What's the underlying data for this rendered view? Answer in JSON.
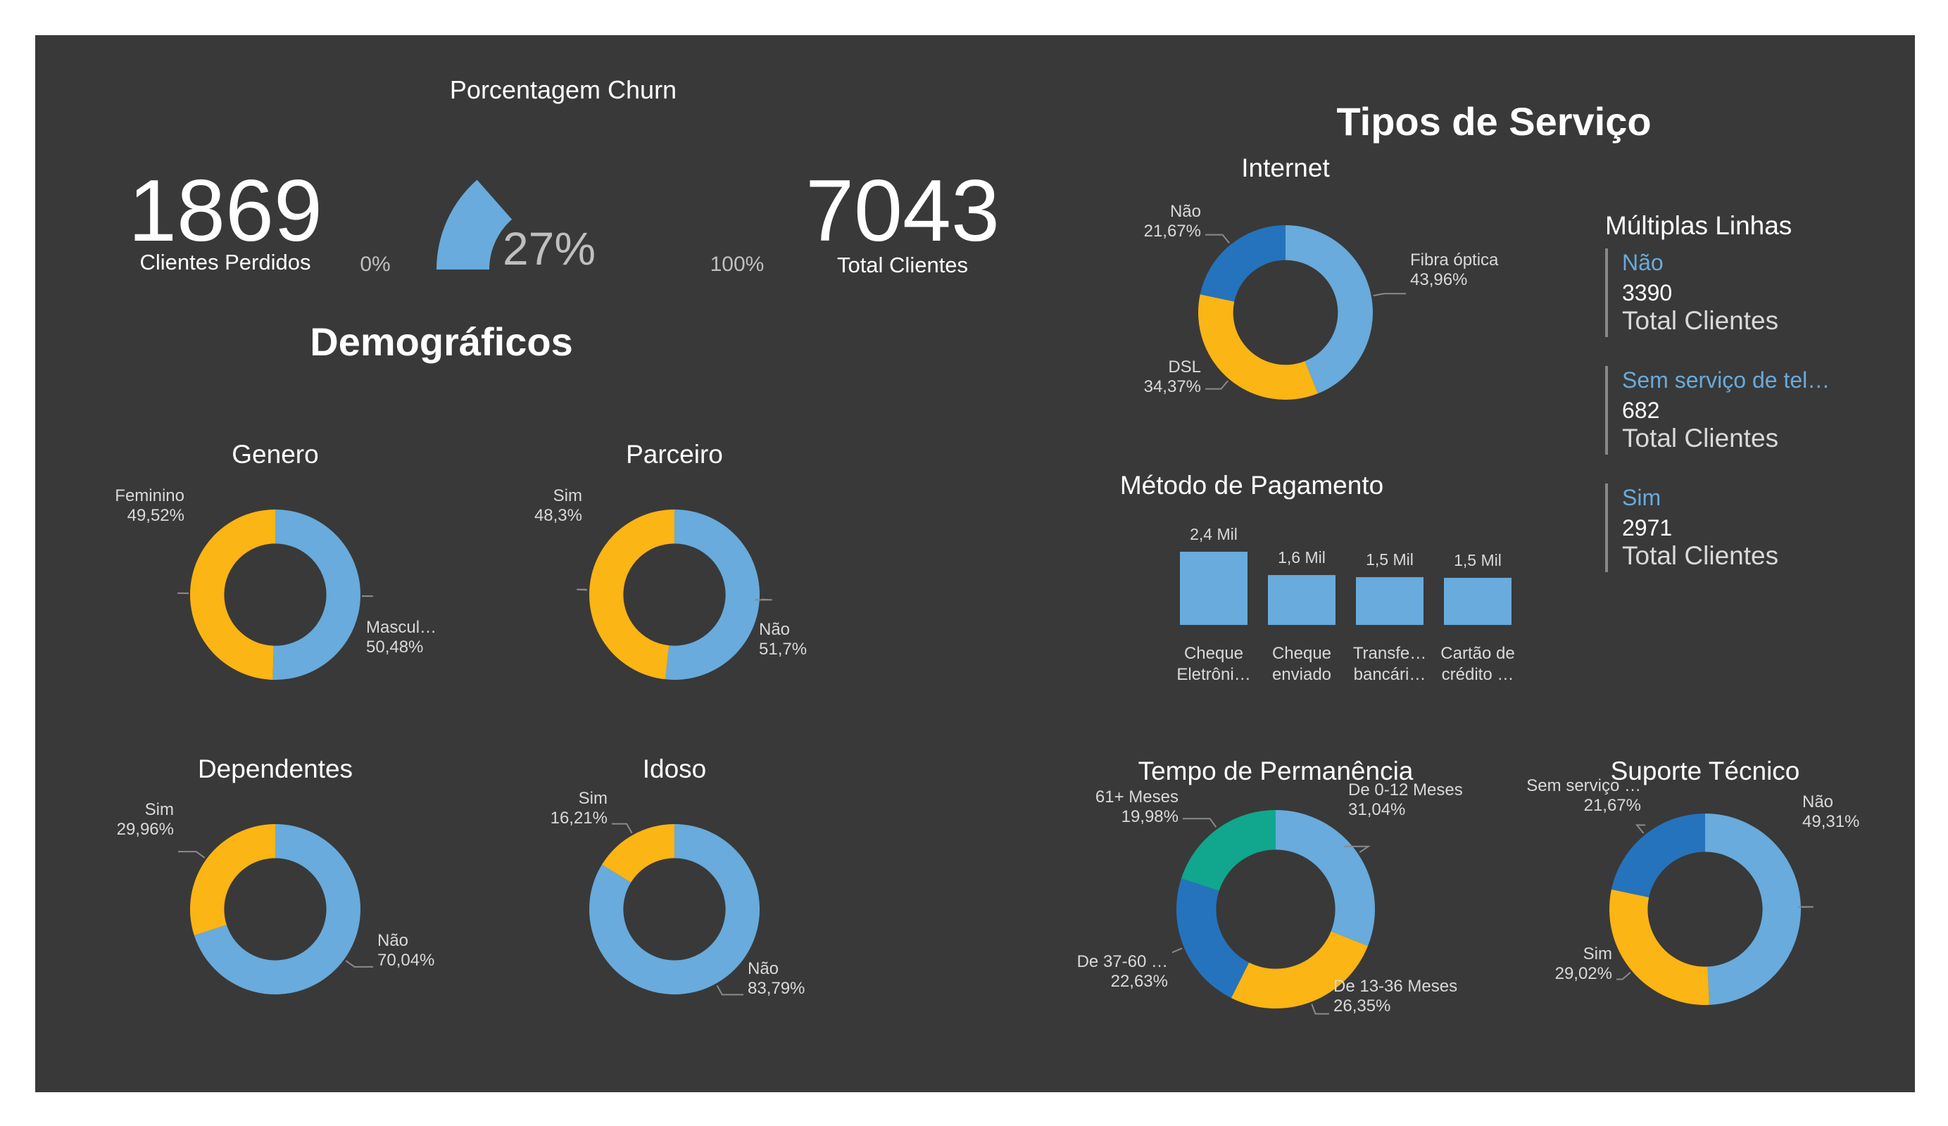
{
  "colors": {
    "background": "#393939",
    "light_blue": "#68abdc",
    "yellow": "#fbb514",
    "dark_blue": "#2573bd",
    "teal": "#10a78e",
    "text": "#ffffff",
    "label": "#d9d9d9",
    "muted": "#bfbfbf",
    "divider": "#888888"
  },
  "kpis": {
    "lost": {
      "value": "1869",
      "label": "Clientes Perdidos"
    },
    "total": {
      "value": "7043",
      "label": "Total Clientes"
    }
  },
  "churn_gauge": {
    "title": "Porcentagem Churn",
    "value_label": "27%",
    "min_label": "0%",
    "max_label": "100%",
    "value": 0.27
  },
  "section_titles": {
    "demographics": "Demográficos",
    "services": "Tipos de Serviço"
  },
  "multiple_lines": {
    "title": "Múltiplas Linhas",
    "cards": [
      {
        "category": "Não",
        "value": "3390",
        "label": "Total Clientes"
      },
      {
        "category": "Sem serviço de tel…",
        "value": "682",
        "label": "Total Clientes"
      },
      {
        "category": "Sim",
        "value": "2971",
        "label": "Total Clientes"
      }
    ]
  },
  "chart_data": [
    {
      "id": "genero",
      "type": "pie",
      "title": "Genero",
      "slices": [
        {
          "label": "Mascul…",
          "pct": "50,48%",
          "value": 50.48,
          "color": "#68abdc"
        },
        {
          "label": "Feminino",
          "pct": "49,52%",
          "value": 49.52,
          "color": "#fbb514"
        }
      ]
    },
    {
      "id": "parceiro",
      "type": "pie",
      "title": "Parceiro",
      "slices": [
        {
          "label": "Não",
          "pct": "51,7%",
          "value": 51.7,
          "color": "#68abdc"
        },
        {
          "label": "Sim",
          "pct": "48,3%",
          "value": 48.3,
          "color": "#fbb514"
        }
      ]
    },
    {
      "id": "dependentes",
      "type": "pie",
      "title": "Dependentes",
      "slices": [
        {
          "label": "Não",
          "pct": "70,04%",
          "value": 70.04,
          "color": "#68abdc"
        },
        {
          "label": "Sim",
          "pct": "29,96%",
          "value": 29.96,
          "color": "#fbb514"
        }
      ]
    },
    {
      "id": "idoso",
      "type": "pie",
      "title": "Idoso",
      "slices": [
        {
          "label": "Não",
          "pct": "83,79%",
          "value": 83.79,
          "color": "#68abdc"
        },
        {
          "label": "Sim",
          "pct": "16,21%",
          "value": 16.21,
          "color": "#fbb514"
        }
      ]
    },
    {
      "id": "internet",
      "type": "pie",
      "title": "Internet",
      "slices": [
        {
          "label": "Fibra óptica",
          "pct": "43,96%",
          "value": 43.96,
          "color": "#68abdc"
        },
        {
          "label": "DSL",
          "pct": "34,37%",
          "value": 34.37,
          "color": "#fbb514"
        },
        {
          "label": "Não",
          "pct": "21,67%",
          "value": 21.67,
          "color": "#2573bd"
        }
      ]
    },
    {
      "id": "pagamento",
      "type": "bar",
      "title": "Método de Pagamento",
      "categories": [
        [
          "Cheque",
          "Eletrôni…"
        ],
        [
          "Cheque",
          "enviado"
        ],
        [
          "Transfe…",
          "bancári…"
        ],
        [
          "Cartão de",
          "crédito …"
        ]
      ],
      "values": [
        2365,
        1612,
        1544,
        1522
      ],
      "data_labels": [
        "2,4 Mil",
        "1,6 Mil",
        "1,5 Mil",
        "1,5 Mil"
      ],
      "color": "#68abdc"
    },
    {
      "id": "permanencia",
      "type": "pie",
      "title": "Tempo de Permanência",
      "slices": [
        {
          "label": "De 0-12 Meses",
          "pct": "31,04%",
          "value": 31.04,
          "color": "#68abdc"
        },
        {
          "label": "De 13-36 Meses",
          "pct": "26,35%",
          "value": 26.35,
          "color": "#fbb514"
        },
        {
          "label": "De 37-60 …",
          "pct": "22,63%",
          "value": 22.63,
          "color": "#2573bd"
        },
        {
          "label": "61+ Meses",
          "pct": "19,98%",
          "value": 19.98,
          "color": "#10a78e"
        }
      ]
    },
    {
      "id": "suporte",
      "type": "pie",
      "title": "Suporte Técnico",
      "slices": [
        {
          "label": "Não",
          "pct": "49,31%",
          "value": 49.31,
          "color": "#68abdc"
        },
        {
          "label": "Sim",
          "pct": "29,02%",
          "value": 29.02,
          "color": "#fbb514"
        },
        {
          "label": "Sem serviço …",
          "pct": "21,67%",
          "value": 21.67,
          "color": "#2573bd"
        }
      ]
    }
  ]
}
